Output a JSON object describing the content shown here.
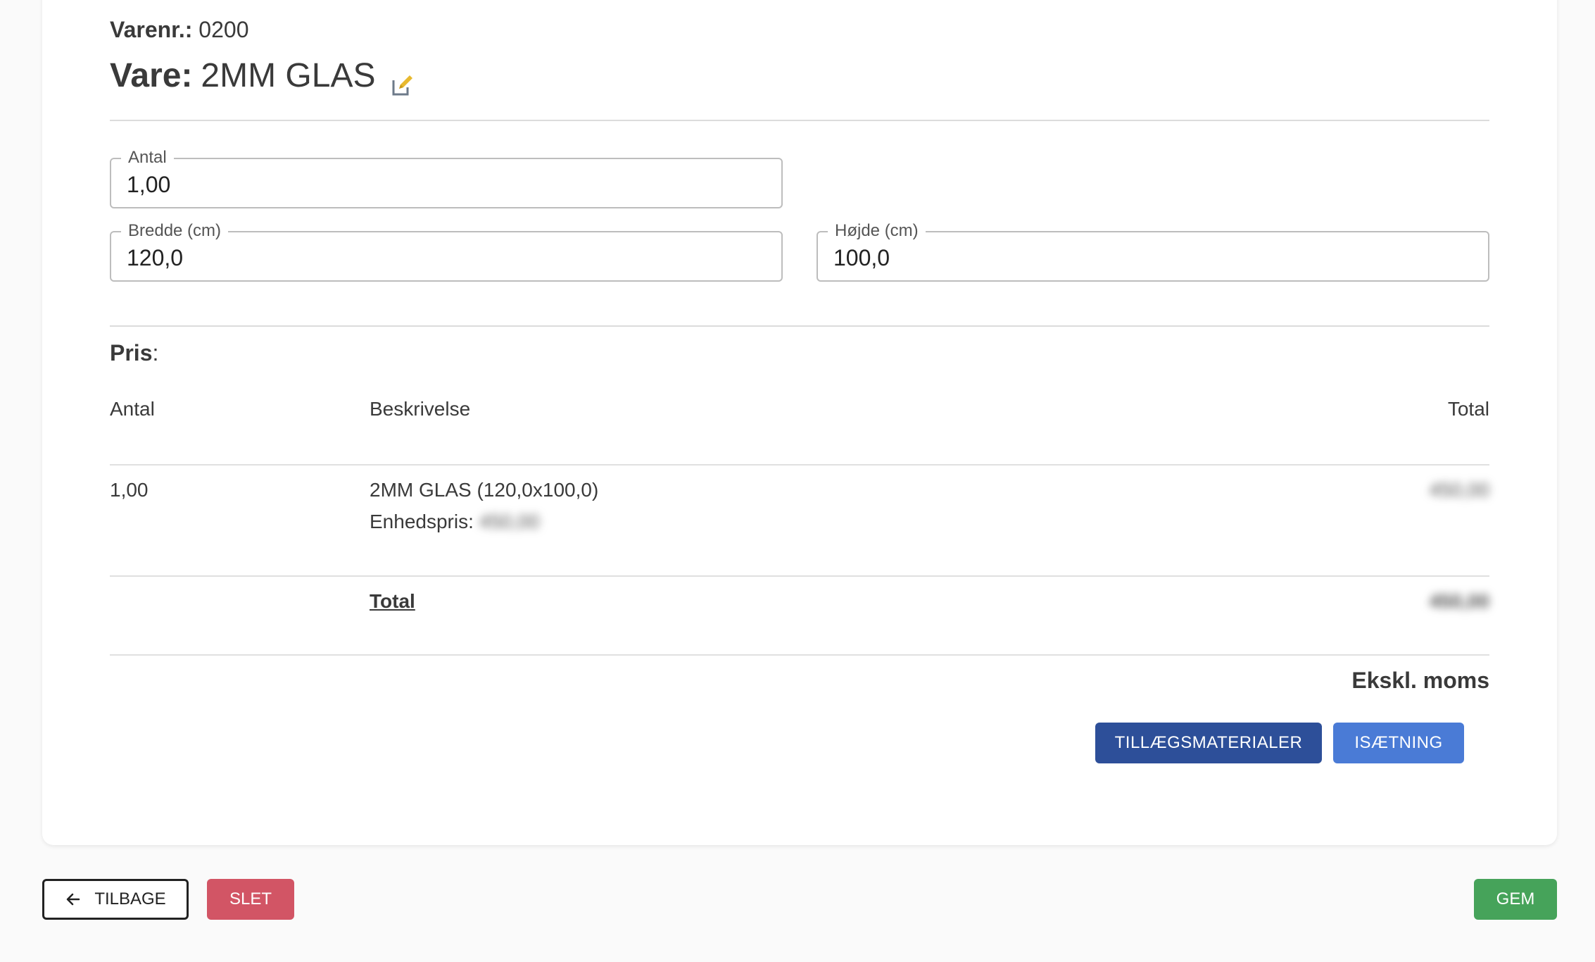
{
  "header": {
    "varenr_label": "Varenr.:",
    "varenr_value": "0200",
    "vare_label": "Vare:",
    "vare_value": "2MM GLAS"
  },
  "fields": {
    "antal": {
      "label": "Antal",
      "value": "1,00"
    },
    "bredde": {
      "label": "Bredde (cm)",
      "value": "120,0"
    },
    "hojde": {
      "label": "Højde (cm)",
      "value": "100,0"
    }
  },
  "pris": {
    "label": "Pris",
    "colon": ":",
    "columns": {
      "antal": "Antal",
      "beskrivelse": "Beskrivelse",
      "total": "Total"
    },
    "rows": [
      {
        "antal": "1,00",
        "beskrivelse": "2MM GLAS (120,0x100,0)",
        "enhedspris_label": "Enhedspris:",
        "enhedspris_value": "450,00",
        "total": "450,00"
      }
    ],
    "total_label": "Total",
    "total_value": "450,00",
    "moms_note": "Ekskl. moms"
  },
  "actions": {
    "tillaeg_label": "TILLÆGSMATERIALER",
    "isaetning_label": "ISÆTNING",
    "tilbage_label": "TILBAGE",
    "slet_label": "SLET",
    "gem_label": "GEM"
  },
  "colors": {
    "tillaeg": "#2d4f99",
    "isaetning": "#4a7bd6",
    "slet": "#d25565",
    "gem": "#46a35a",
    "edit_icon": "#e8b92f"
  },
  "icons": {
    "edit": "pencil-edit-icon",
    "back": "arrow-left-icon"
  }
}
